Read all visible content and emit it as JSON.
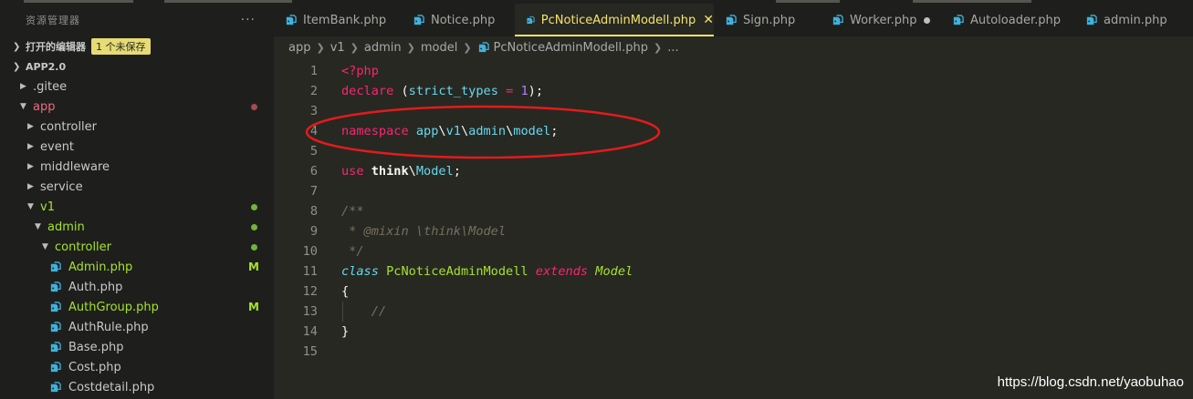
{
  "explorer": {
    "title": "资源管理器",
    "more": "···",
    "open_editors": {
      "label": "打开的编辑器",
      "badge": "1 个未保存"
    },
    "root": {
      "label": "APP2.0"
    },
    "tree": [
      {
        "name": ".gitee",
        "depth": 0,
        "type": "folder",
        "open": false,
        "color": "normal"
      },
      {
        "name": "app",
        "depth": 0,
        "type": "folder",
        "open": true,
        "color": "red",
        "dot": "red"
      },
      {
        "name": "controller",
        "depth": 1,
        "type": "folder",
        "open": false,
        "color": "normal"
      },
      {
        "name": "event",
        "depth": 1,
        "type": "folder",
        "open": false,
        "color": "normal"
      },
      {
        "name": "middleware",
        "depth": 1,
        "type": "folder",
        "open": false,
        "color": "normal"
      },
      {
        "name": "service",
        "depth": 1,
        "type": "folder",
        "open": false,
        "color": "normal"
      },
      {
        "name": "v1",
        "depth": 1,
        "type": "folder",
        "open": true,
        "color": "green",
        "dot": "green"
      },
      {
        "name": "admin",
        "depth": 2,
        "type": "folder",
        "open": true,
        "color": "green",
        "dot": "green"
      },
      {
        "name": "controller",
        "depth": 3,
        "type": "folder",
        "open": true,
        "color": "green",
        "dot": "green"
      },
      {
        "name": "Admin.php",
        "depth": 4,
        "type": "file",
        "color": "green",
        "badge": "M"
      },
      {
        "name": "Auth.php",
        "depth": 4,
        "type": "file",
        "color": "normal"
      },
      {
        "name": "AuthGroup.php",
        "depth": 4,
        "type": "file",
        "color": "green",
        "badge": "M"
      },
      {
        "name": "AuthRule.php",
        "depth": 4,
        "type": "file",
        "color": "normal"
      },
      {
        "name": "Base.php",
        "depth": 4,
        "type": "file",
        "color": "normal"
      },
      {
        "name": "Cost.php",
        "depth": 4,
        "type": "file",
        "color": "normal"
      },
      {
        "name": "Costdetail.php",
        "depth": 4,
        "type": "file",
        "color": "normal"
      }
    ]
  },
  "tabs": [
    {
      "label": "ItemBank.php",
      "active": false
    },
    {
      "label": "Notice.php",
      "active": false
    },
    {
      "label": "PcNoticeAdminModell.php",
      "active": true,
      "close": "✕"
    },
    {
      "label": "Sign.php",
      "active": false
    },
    {
      "label": "Worker.php",
      "active": false,
      "modified": true
    },
    {
      "label": "Autoloader.php",
      "active": false
    },
    {
      "label": "admin.php",
      "active": false
    }
  ],
  "breadcrumb": [
    "app",
    "v1",
    "admin",
    "model",
    "PcNoticeAdminModell.php",
    "..."
  ],
  "code": [
    {
      "n": "1",
      "tokens": [
        [
          "<?php",
          "tag"
        ]
      ]
    },
    {
      "n": "2",
      "tokens": [
        [
          "declare ",
          "kw"
        ],
        [
          "(",
          "pun"
        ],
        [
          "strict_types",
          "ns"
        ],
        [
          " = ",
          "kw"
        ],
        [
          "1",
          "num"
        ],
        [
          ");",
          "pun"
        ]
      ]
    },
    {
      "n": "3",
      "tokens": []
    },
    {
      "n": "4",
      "tokens": [
        [
          "namespace ",
          "kw"
        ],
        [
          "app",
          "ns"
        ],
        [
          "\\",
          "pun"
        ],
        [
          "v1",
          "ns"
        ],
        [
          "\\",
          "pun"
        ],
        [
          "admin",
          "ns"
        ],
        [
          "\\",
          "pun"
        ],
        [
          "model",
          "ns"
        ],
        [
          ";",
          "pun"
        ]
      ]
    },
    {
      "n": "5",
      "tokens": []
    },
    {
      "n": "6",
      "tokens": [
        [
          "use ",
          "kw"
        ],
        [
          "think",
          "bold"
        ],
        [
          "\\",
          "pun"
        ],
        [
          "Model",
          "ns"
        ],
        [
          ";",
          "pun"
        ]
      ]
    },
    {
      "n": "7",
      "tokens": []
    },
    {
      "n": "8",
      "tokens": [
        [
          "/**",
          "cm"
        ]
      ]
    },
    {
      "n": "9",
      "tokens": [
        [
          " * @mixin \\think\\Model",
          "cm"
        ]
      ]
    },
    {
      "n": "10",
      "tokens": [
        [
          " */",
          "cm"
        ]
      ]
    },
    {
      "n": "11",
      "tokens": [
        [
          "class ",
          "kwi"
        ],
        [
          "PcNoticeAdminModell ",
          "cls"
        ],
        [
          "extends ",
          "ext"
        ],
        [
          "Model",
          "base"
        ]
      ]
    },
    {
      "n": "12",
      "tokens": [
        [
          "{",
          "pun"
        ]
      ]
    },
    {
      "n": "13",
      "tokens": [
        [
          "    //",
          "cm"
        ]
      ],
      "guide": true
    },
    {
      "n": "14",
      "tokens": [
        [
          "}",
          "pun"
        ]
      ]
    },
    {
      "n": "15",
      "tokens": []
    }
  ],
  "colors": {
    "annotation_ellipse": "#e31b1b",
    "php_icon": "#3fb2dd",
    "active_tab": "#f6e36a"
  },
  "watermark": "https://blog.csdn.net/yaobuhao"
}
